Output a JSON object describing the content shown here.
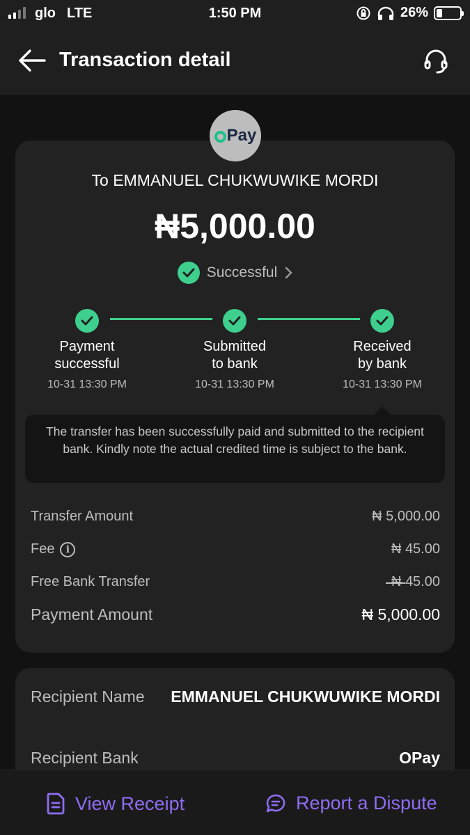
{
  "status_bar": {
    "carrier": "glo",
    "network": "LTE",
    "time": "1:50 PM",
    "battery": "26%",
    "battery_level": 0.26
  },
  "header": {
    "title": "Transaction detail"
  },
  "logo": {
    "text": "Pay"
  },
  "summary": {
    "recipient_line": "To EMMANUEL CHUKWUWIKE MORDI",
    "amount": "₦5,000.00",
    "status": "Successful"
  },
  "timeline": [
    {
      "line1": "Payment",
      "line2": "successful",
      "time": "10-31 13:30 PM"
    },
    {
      "line1": "Submitted",
      "line2": "to bank",
      "time": "10-31 13:30 PM"
    },
    {
      "line1": "Received",
      "line2": "by bank",
      "time": "10-31 13:30 PM"
    }
  ],
  "tooltip": "The transfer has been successfully paid and submitted to the recipient bank. Kindly note the actual credited time is subject to the bank.",
  "breakdown": {
    "transfer_amount": {
      "label": "Transfer Amount",
      "value": "₦ 5,000.00"
    },
    "fee": {
      "label": "Fee",
      "value": "₦ 45.00"
    },
    "free_transfer": {
      "label": "Free Bank Transfer",
      "value": "₦ 45.00"
    },
    "payment_amount": {
      "label": "Payment Amount",
      "value": "₦ 5,000.00"
    }
  },
  "details": {
    "recipient_name": {
      "label": "Recipient Name",
      "value": "EMMANUEL CHUKWUWIKE MORDI"
    },
    "recipient_bank": {
      "label": "Recipient Bank",
      "value": "OPay"
    }
  },
  "actions": {
    "view_receipt": "View Receipt",
    "report_dispute": "Report a Dispute"
  },
  "colors": {
    "accent": "#8f6df2",
    "success": "#3ecf8e",
    "card": "#222222",
    "background": "#121212"
  }
}
